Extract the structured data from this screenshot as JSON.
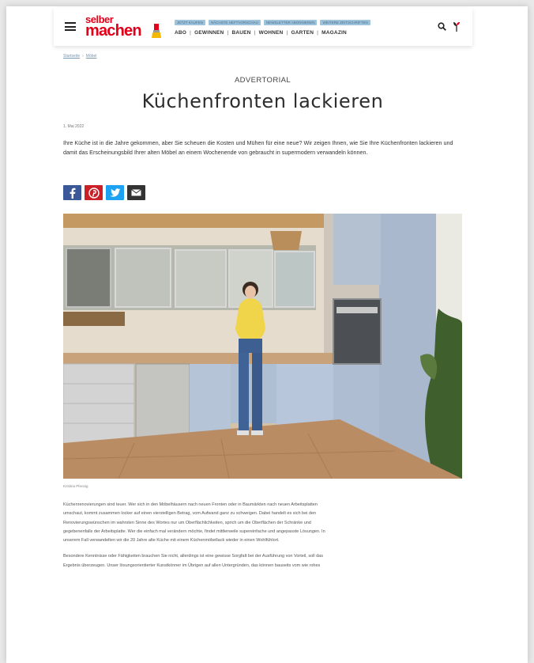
{
  "header": {
    "logo_top": "selber",
    "logo_main": "machen",
    "promo_tags": [
      "JETZT KAUFEN",
      "NÄCHSTE HEFTVORSCHAU",
      "NEWSLETTER ABONNIEREN",
      "WEITERE ZEITSCHRIFTEN"
    ],
    "nav": [
      "ABO",
      "GEWINNEN",
      "BAUEN",
      "WOHNEN",
      "GARTEN",
      "MAGAZIN"
    ]
  },
  "breadcrumb": [
    "Startseite",
    "Möbel"
  ],
  "article": {
    "kicker": "ADVERTORIAL",
    "title": "Küchenfronten lackieren",
    "date": "1. Mai 2022",
    "intro": "Ihre Küche ist in die Jahre gekommen, aber Sie scheuen die Kosten und Mühen für eine neue? Wir zeigen Ihnen, wie Sie Ihre Küchenfronten lackieren und damit das Erscheinungsbild Ihrer alten Möbel an einem Wochenende von gebraucht in supermodern verwandeln können.",
    "image_credit": "Kristina Pfennig",
    "paragraph_1": "Küchenrenovierungen sind teuer. Wer sich in den Möbelhäusern nach neuen Fronten oder in Baumärkten nach neuen Arbeitsplatten umschaut, kommt zusammen locker auf einen vierstelligen Betrag, vom Aufwand ganz zu schweigen. Dabei handelt es sich bei den Renovierungswünschen im wahrsten Sinne des Wortes nur um Oberflächlichkeiten, sprich um die Oberflächen der Schränke und gegebenenfalls der Arbeitsplatte. Wer die einfach mal verändern möchte, findet mittlerweile supereinfache und angepasste Lösungen. In unserem Fall verwandelten wir die 20 Jahre alte Küche mit einem Küchenmöbellack wieder in einen Wohlfühlort.",
    "paragraph_2": "Besondere Kenntnisse oder Fähigkeiten brauchen Sie nicht, allerdings ist eine gewisse Sorgfalt bei der Ausführung von Vorteil, soll das Ergebnis überzeugen. Unser lösungsorientierter Kunstkönner im Übrigen auf allen Untergründen, das können bauseits vom wie rohes"
  },
  "share": {
    "facebook_color": "#3b5998",
    "pinterest_color": "#cb2027",
    "twitter_color": "#1da1f2",
    "email_color": "#333333"
  },
  "colors": {
    "brand_red": "#e2001a",
    "promo_blue": "#9ec3dd"
  }
}
